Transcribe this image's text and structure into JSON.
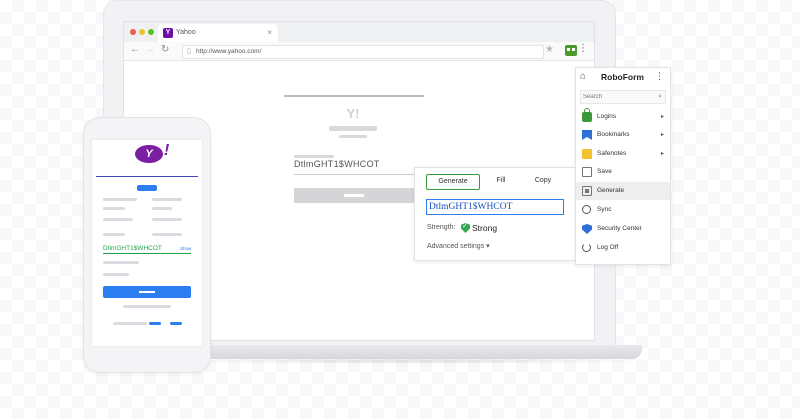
{
  "browser": {
    "tab_title": "Yahoo",
    "tab_close": "×",
    "url": "http://www.yahoo.com/"
  },
  "page": {
    "logo_text": "Y!",
    "password_field_value": "DtlmGHT1$WHCOT"
  },
  "phone": {
    "logo_text": "Y",
    "logo_exclaim": "!",
    "password_value": "DtlmGHT1$WHCOT",
    "show_label": "Show"
  },
  "generator": {
    "tabs": [
      "Generate",
      "Fill",
      "Copy"
    ],
    "active_tab": "Generate",
    "output": "DtlmGHT1$WHCOT",
    "strength_label": "Strength:",
    "strength_value": "Strong",
    "advanced_label": "Advanced settings ▾"
  },
  "roboform": {
    "title": "RoboForm",
    "search_placeholder": "Search",
    "items": [
      {
        "label": "Logins",
        "has_submenu": true
      },
      {
        "label": "Bookmarks",
        "has_submenu": true
      },
      {
        "label": "Safenotes",
        "has_submenu": true
      },
      {
        "label": "Save",
        "has_submenu": false
      },
      {
        "label": "Generate",
        "has_submenu": false,
        "highlighted": true
      },
      {
        "label": "Sync",
        "has_submenu": false
      },
      {
        "label": "Security Center",
        "has_submenu": false
      },
      {
        "label": "Log Off",
        "has_submenu": false
      }
    ]
  },
  "colors": {
    "yahoo_purple": "#7b1fa2",
    "roboform_green": "#3a9a3a",
    "link_blue": "#2d7ef0",
    "strong_green": "#2fa84f"
  }
}
